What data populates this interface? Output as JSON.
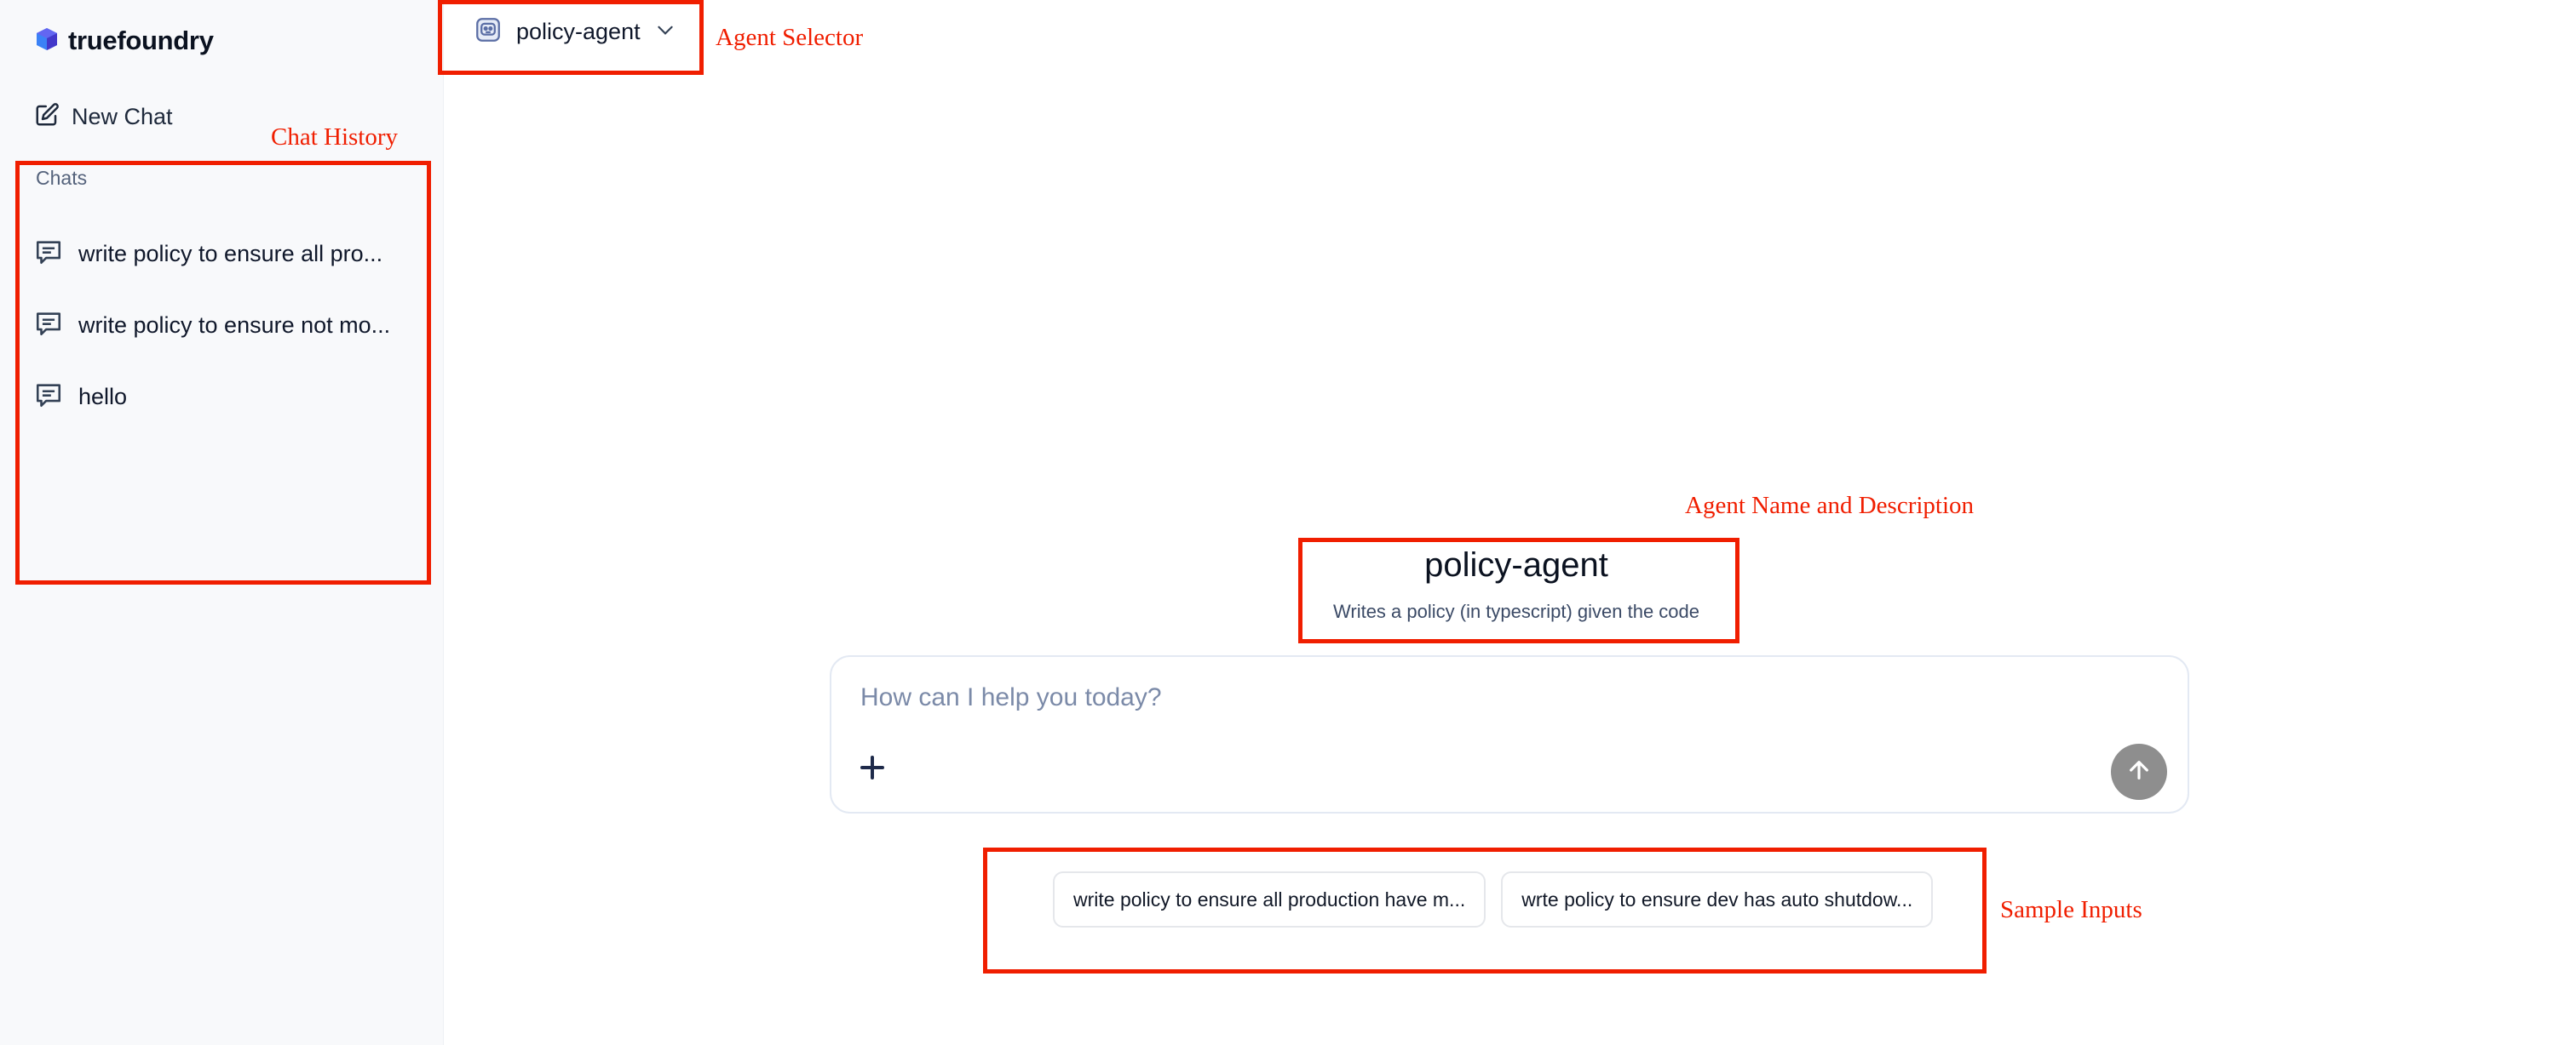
{
  "sidebar": {
    "logo_text": "truefoundry",
    "new_chat_label": "New Chat",
    "chats_heading": "Chats",
    "items": [
      {
        "label": "write policy to ensure all pro..."
      },
      {
        "label": "write policy to ensure not mo..."
      },
      {
        "label": "hello"
      }
    ]
  },
  "header": {
    "agent_selector_label": "policy-agent"
  },
  "main": {
    "agent_title": "policy-agent",
    "agent_description": "Writes a policy (in typescript) given the code",
    "composer": {
      "placeholder": "How can I help you today?",
      "value": ""
    },
    "sample_inputs": [
      "write policy to ensure all production have m...",
      "wrte policy to ensure dev has auto shutdow..."
    ]
  },
  "annotations": {
    "agent_selector": "Agent Selector",
    "chat_history": "Chat History",
    "agent_name_description": "Agent Name and Description",
    "sample_inputs": "Sample Inputs"
  },
  "colors": {
    "annotation": "#f01e00",
    "logo_accent": "#4f46e5",
    "send_button": "#8e8e8e",
    "sidebar_bg": "#f8f9fb"
  }
}
